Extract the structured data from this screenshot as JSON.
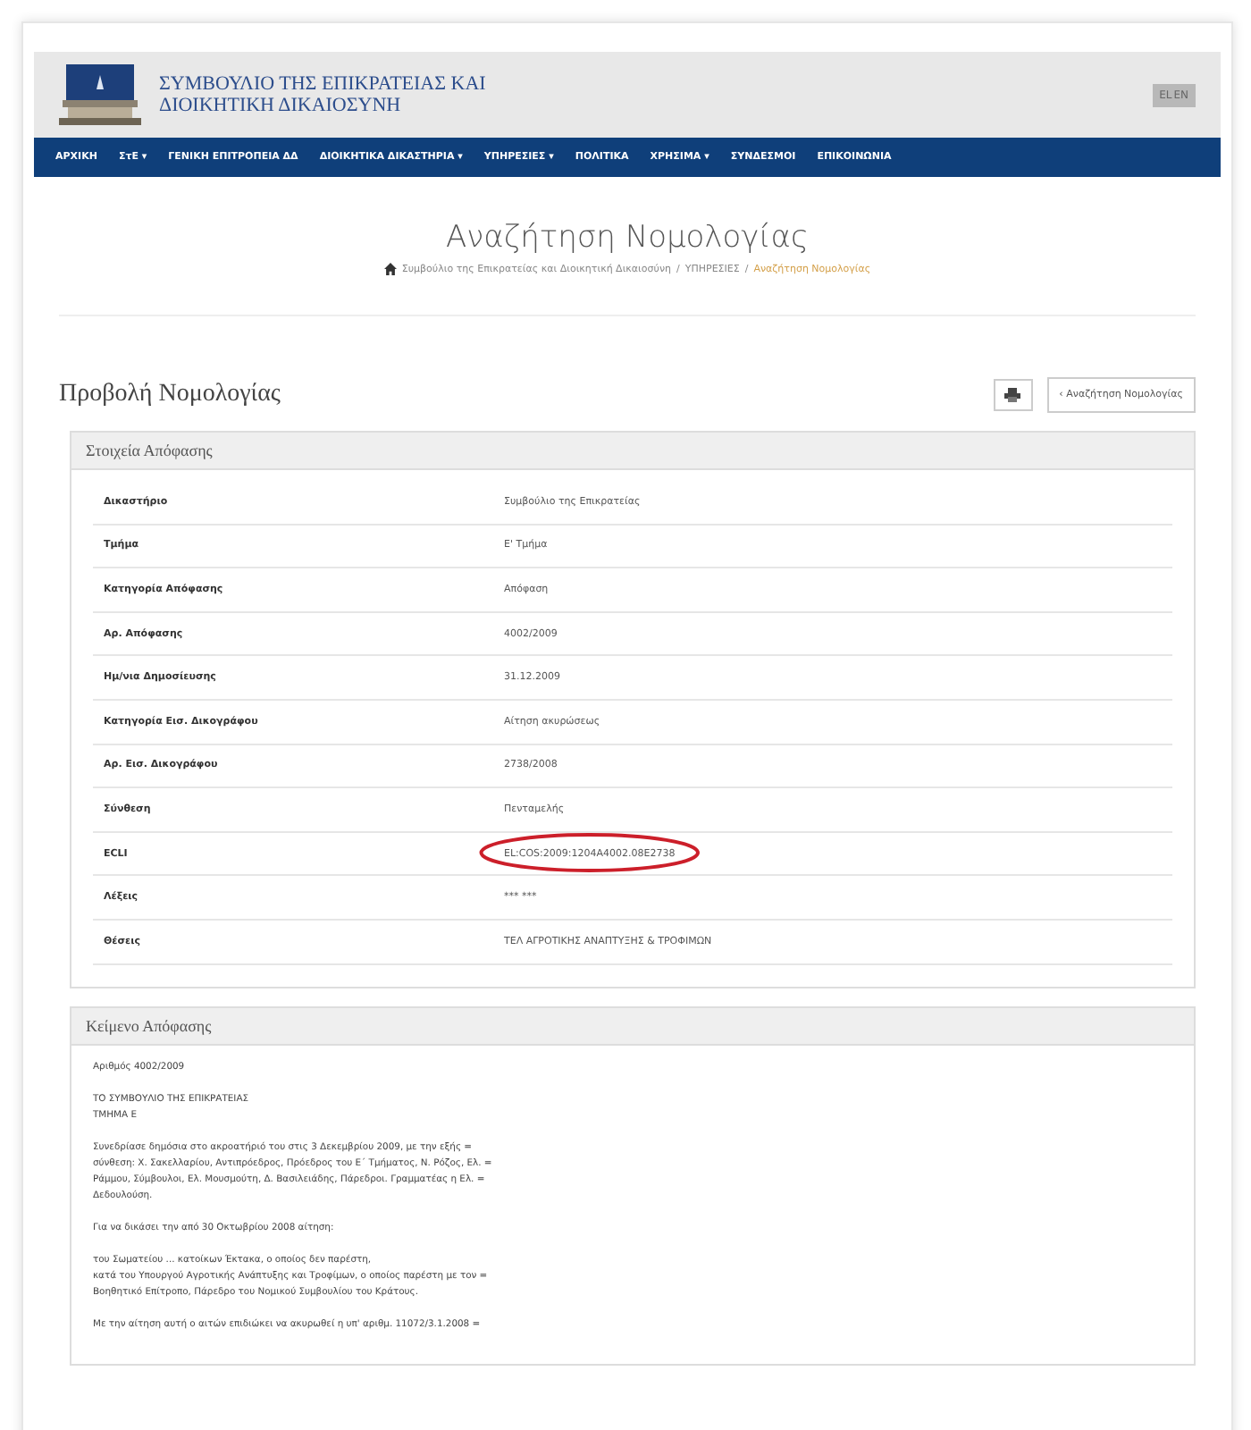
{
  "header": {
    "title_lines": [
      "ΣΥΜΒΟΥΛΙΟ ΤΗΣ ΕΠΙΚΡΑΤΕΙΑΣ ΚΑΙ",
      "ΔΙΟΙΚΗΤΙΚΗ ΔΙΚΑΙΟΣΥΝΗ"
    ],
    "languages": [
      "EL",
      "EN"
    ]
  },
  "nav": [
    "ΑΡΧΙΚΗ",
    "ΣτΕ ▾",
    "ΓΕΝΙΚΗ ΕΠΙΤΡΟΠΕΙΑ ΔΔ",
    "ΔΙΟΙΚΗΤΙΚΑ ΔΙΚΑΣΤΗΡΙΑ ▾",
    "ΥΠΗΡΕΣΙΕΣ ▾",
    "ΠΟΛΙΤΙΚΑ",
    "ΧΡΗΣΙΜΑ ▾",
    "ΣΥΝΔΕΣΜΟΙ",
    "ΕΠΙΚΟΙΝΩΝΙΑ"
  ],
  "page_title": "Αναζήτηση Νομολογίας",
  "breadcrumb": [
    {
      "kind": "link",
      "text": "Συμβούλιο της Επικρατείας και Διοικητική Δικαιοσύνη"
    },
    {
      "kind": "separator",
      "text": "/"
    },
    {
      "kind": "link",
      "text": "ΥΠΗΡΕΣΙΕΣ"
    },
    {
      "kind": "separator",
      "text": "/"
    },
    {
      "kind": "current",
      "text": "Αναζήτηση Νομολογίας"
    }
  ],
  "section_title": "Προβολή Νομολογίας",
  "back_button": "‹ Αναζήτηση Νομολογίας",
  "details_panel": {
    "title": "Στοιχεία Απόφασης",
    "rows": [
      {
        "label": "Δικαστήριο",
        "value": "Συμβούλιο της Επικρατείας",
        "circled": false
      },
      {
        "label": "Τμήμα",
        "value": "Ε' Τμήμα",
        "circled": false
      },
      {
        "label": "Κατηγορία Απόφασης",
        "value": "Απόφαση",
        "circled": false
      },
      {
        "label": "Αρ. Απόφασης",
        "value": "4002/2009",
        "circled": false
      },
      {
        "label": "Ημ/νια Δημοσίευσης",
        "value": "31.12.2009",
        "circled": false
      },
      {
        "label": "Κατηγορία Εισ. Δικογράφου",
        "value": "Αίτηση ακυρώσεως",
        "circled": false
      },
      {
        "label": "Αρ. Εισ. Δικογράφου",
        "value": "2738/2008",
        "circled": false
      },
      {
        "label": "Σύνθεση",
        "value": "Πενταμελής",
        "circled": false
      },
      {
        "label": "ECLI",
        "value": "EL:COS:2009:1204A4002.08E2738",
        "circled": true
      },
      {
        "label": "Λέξεις",
        "value": "*** ***",
        "circled": false
      },
      {
        "label": "Θέσεις",
        "value": "ΤΕΛ ΑΓΡΟΤΙΚΗΣ ΑΝΑΠΤΥΞΗΣ & ΤΡΟΦΙΜΩΝ",
        "circled": false
      }
    ]
  },
  "text_panel": {
    "title": "Κείμενο Απόφασης",
    "paragraphs": [
      [
        "Αριθμός 4002/2009"
      ],
      [
        "ΤΟ ΣΥΜΒΟΥΛΙΟ ΤΗΣ ΕΠΙΚΡΑΤΕΙΑΣ",
        "ΤΜΗΜΑ Ε"
      ],
      [
        "Συνεδρίασε δημόσια στο ακροατήριό του στις 3 Δεκεμβρίου 2009, με την εξής =",
        "σύνθεση: Χ. Σακελλαρίου, Αντιπρόεδρος, Πρόεδρος του Ε΄ Τμήματος, Ν. Ρόζος, Ελ. =",
        "Ράμμου, Σύμβουλοι, Ελ. Μουσμούτη, Δ. Βασιλειάδης, Πάρεδροι. Γραμματέας η Ελ. =",
        "Δεδουλούση."
      ],
      [
        "Για να δικάσει την από 30 Οκτωβρίου 2008 αίτηση:"
      ],
      [
        "του Σωματείου ... κατοίκων Έκτακα, ο οποίος δεν παρέστη,",
        "κατά του Υπουργού Αγροτικής Ανάπτυξης και Τροφίμων, ο οποίος παρέστη με τον =",
        "Βοηθητικό Επίτροπο, Πάρεδρο του Νομικού Συμβουλίου του Κράτους."
      ],
      [
        "Με την αίτηση αυτή ο αιτών επιδιώκει να ακυρωθεί η υπ' αριθμ. 11072/3.1.2008 ="
      ]
    ]
  }
}
